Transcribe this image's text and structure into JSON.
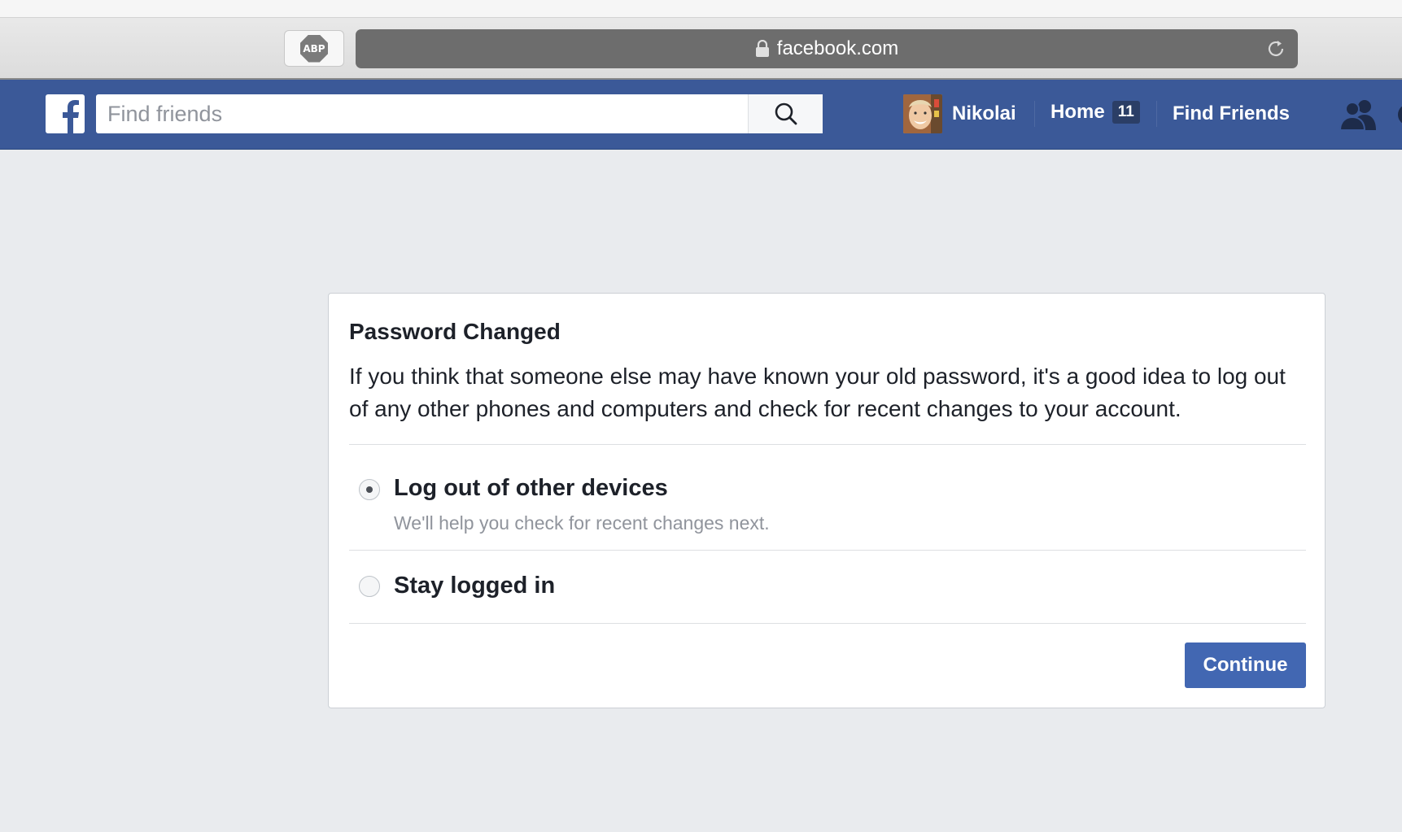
{
  "browser": {
    "adblock_label": "ABP",
    "url": "facebook.com"
  },
  "topbar": {
    "search_placeholder": "Find friends",
    "profile_name": "Nikolai",
    "home_label": "Home",
    "home_count": "11",
    "find_friends_label": "Find Friends",
    "brand_color": "#3b5998"
  },
  "dialog": {
    "title": "Password Changed",
    "body": "If you think that someone else may have known your old password, it's a good idea to log out of any other phones and computers and check for recent changes to your account.",
    "options": [
      {
        "label": "Log out of other devices",
        "sublabel": "We'll help you check for recent changes next.",
        "selected": true
      },
      {
        "label": "Stay logged in",
        "selected": false
      }
    ],
    "continue_label": "Continue"
  },
  "icons": {
    "lock": "lock-icon",
    "reload": "reload-icon",
    "search": "search-icon",
    "friends": "friend-requests-icon"
  }
}
